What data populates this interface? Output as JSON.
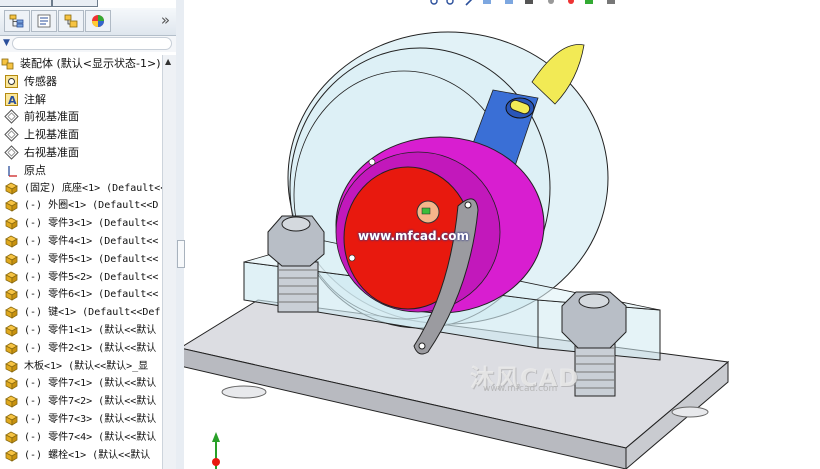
{
  "feature_manager": {
    "more_label": "»",
    "tabs": [
      {
        "name": "featuremanager-tab-icon"
      },
      {
        "name": "propertymanager-tab-icon"
      },
      {
        "name": "configurationmanager-tab-icon"
      },
      {
        "name": "appearance-tab-icon"
      }
    ],
    "tree": [
      {
        "icon": "assembly-icon",
        "text": "装配体  (默认<显示状态-1>)"
      },
      {
        "icon": "sensor-icon",
        "text": "传感器"
      },
      {
        "icon": "annotation-icon",
        "text": "注解"
      },
      {
        "icon": "plane-icon",
        "text": "前视基准面"
      },
      {
        "icon": "plane-icon",
        "text": "上视基准面"
      },
      {
        "icon": "plane-icon",
        "text": "右视基准面"
      },
      {
        "icon": "origin-icon",
        "text": "原点"
      },
      {
        "icon": "part-icon",
        "text": "(固定) 底座<1> (Default<<Default"
      },
      {
        "icon": "part-icon",
        "text": "(-) 外圈<1> (Default<<D"
      },
      {
        "icon": "part-icon",
        "text": "(-) 零件3<1> (Default<<"
      },
      {
        "icon": "part-icon",
        "text": "(-) 零件4<1> (Default<<"
      },
      {
        "icon": "part-icon",
        "text": "(-) 零件5<1> (Default<<"
      },
      {
        "icon": "part-icon",
        "text": "(-) 零件5<2> (Default<<"
      },
      {
        "icon": "part-icon",
        "text": "(-) 零件6<1> (Default<<"
      },
      {
        "icon": "part-icon",
        "text": "(-) 键<1> (Default<<Def"
      },
      {
        "icon": "part-icon",
        "text": "(-) 零件1<1> (默认<<默认"
      },
      {
        "icon": "part-icon",
        "text": "(-) 零件2<1> (默认<<默认"
      },
      {
        "icon": "part-icon",
        "text": "木板<1> (默认<<默认>_显"
      },
      {
        "icon": "part-icon",
        "text": "(-) 零件7<1> (默认<<默认"
      },
      {
        "icon": "part-icon",
        "text": "(-) 零件7<2> (默认<<默认"
      },
      {
        "icon": "part-icon",
        "text": "(-) 零件7<3> (默认<<默认"
      },
      {
        "icon": "part-icon",
        "text": "(-) 零件7<4> (默认<<默认"
      },
      {
        "icon": "part-icon",
        "text": "(-) 螺栓<1> (默认<<默认"
      }
    ]
  },
  "graphics": {
    "watermark_url": "www.mfcad.com",
    "watermark_logo": "沐风CAD",
    "watermark_site": "www.mfcad.com",
    "triad_label": "Y"
  },
  "colors": {
    "assembly_red": "#e8190e",
    "hub_magenta": "#d81ed0",
    "shaft_blue": "#3a6fd6",
    "shaft_tip_yellow": "#f2ea55",
    "transparent_body": "#cfe9f1",
    "base_plate_gray": "#d7d9de",
    "arm_gray": "#9b9ba0"
  }
}
